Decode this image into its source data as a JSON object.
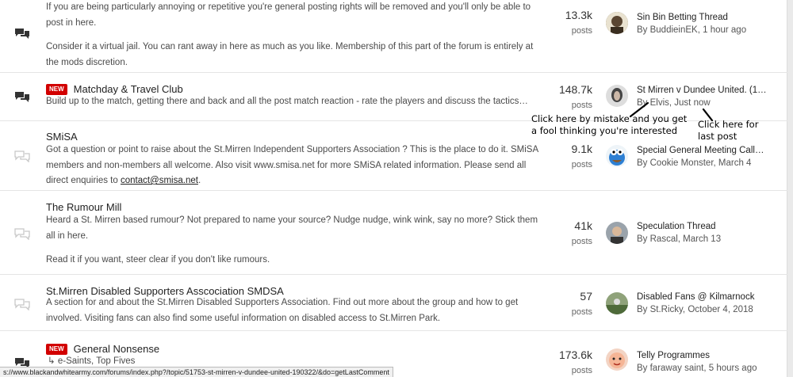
{
  "forums": [
    {
      "title": "",
      "description": [
        "If you are being particularly annoying or repetitive you're general posting rights will be removed and you'll only be able to post in here.",
        "Consider it a virtual jail. You can rant away in here as much as you like. Membership of this part of the forum is entirely at the mods discretion."
      ],
      "count": "13.3k",
      "count_label": "posts",
      "last_title": "Sin Bin Betting Thread",
      "last_by": "By BuddieinEK, 1 hour ago",
      "has_new": false,
      "unread": true
    },
    {
      "title": "Matchday & Travel Club",
      "badge": "NEW",
      "description": [
        "Build up to the match, getting there and back and all the post match reaction - rate the players and discuss the tactics…"
      ],
      "count": "148.7k",
      "count_label": "posts",
      "last_title": "St Mirren v Dundee United. (1…",
      "last_by": "By Elvis, Just now",
      "unread": true
    },
    {
      "title": "SMiSA",
      "description_html_parts": {
        "text": "Got a question or point to raise about the St.Mirren Independent Supporters Association ? This is the place to do it. SMiSA members and non-members all welcome. Also visit www.smisa.net for more SMiSA related information. Please send all direct enquiries to ",
        "link": "contact@smisa.net",
        "end": "."
      },
      "count": "9.1k",
      "count_label": "posts",
      "last_title": "Special General Meeting Call…",
      "last_by": "By Cookie Monster, March 4",
      "unread": false
    },
    {
      "title": "The Rumour Mill",
      "description": [
        "Heard a St. Mirren based rumour? Not prepared to name your source? Nudge nudge, wink wink, say no more? Stick them all in here.",
        "Read it if you want, steer clear if you don't like rumours."
      ],
      "count": "41k",
      "count_label": "posts",
      "last_title": "Speculation Thread",
      "last_by": "By Rascal, March 13",
      "unread": false
    },
    {
      "title": "St.Mirren Disabled Supporters Asscociation SMDSA",
      "description": [
        "A section for and about the St.Mirren Disabled Supporters Association. Find out more about the group and how to get involved. Visiting fans can also find some useful information on disabled access to St.Mirren Park."
      ],
      "count": "57",
      "count_label": "posts",
      "last_title": "Disabled Fans @ Kilmarnock",
      "last_by": "By St.Ricky, October 4, 2018",
      "unread": false
    },
    {
      "title": "General Nonsense",
      "badge": "NEW",
      "subforums": "e-Saints,  Top Fives",
      "count": "173.6k",
      "count_label": "posts",
      "last_title": "Telly Programmes",
      "last_by": "By faraway saint, 5 hours ago",
      "unread": true
    }
  ],
  "annotations": {
    "left_line1": "Click here by mistake and you get",
    "left_line2": "a fool thinking you're interested",
    "right_line1": "Click here for",
    "right_line2": "last post"
  },
  "status_url": "s://www.blackandwhitearmy.com/forums/index.php?/topic/51753-st-mirren-v-dundee-united-190322/&do=getLastComment",
  "colors": {
    "badge": "#d20000",
    "unread_icon": "#333333",
    "read_icon": "#c8c8c8"
  }
}
